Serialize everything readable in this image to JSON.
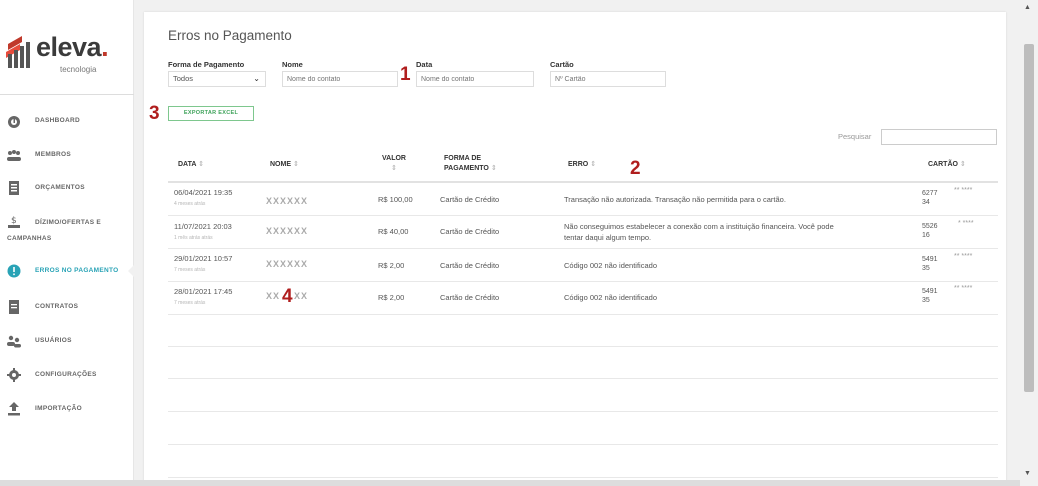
{
  "brand": {
    "name": "eleva",
    "dot": ".",
    "tagline": "tecnologia"
  },
  "sidebar": {
    "items": [
      {
        "label": "DASHBOARD",
        "icon": "dashboard-icon"
      },
      {
        "label": "MEMBROS",
        "icon": "members-icon"
      },
      {
        "label": "ORÇAMENTOS",
        "icon": "budget-icon"
      },
      {
        "label": "DÍZIMO/OFERTAS E",
        "label2": "CAMPANHAS",
        "icon": "tithe-icon"
      },
      {
        "label": "ERROS NO PAGAMENTO",
        "icon": "alert-icon",
        "active": true
      },
      {
        "label": "CONTRATOS",
        "icon": "contract-icon"
      },
      {
        "label": "USUÁRIOS",
        "icon": "users-icon"
      },
      {
        "label": "CONFIGURAÇÕES",
        "icon": "gear-icon"
      },
      {
        "label": "IMPORTAÇÃO",
        "icon": "upload-icon"
      }
    ]
  },
  "page": {
    "title": "Erros no Pagamento"
  },
  "filters": {
    "payment_method": {
      "label": "Forma de Pagamento",
      "value": "Todos"
    },
    "name": {
      "label": "Nome",
      "placeholder": "Nome do contato"
    },
    "date": {
      "label": "Data",
      "placeholder": "Nome do contato"
    },
    "card": {
      "label": "Cartão",
      "placeholder": "Nº Cartão"
    }
  },
  "export_button": "EXPORTAR EXCEL",
  "search": {
    "label": "Pesquisar"
  },
  "table": {
    "columns": {
      "date": "DATA",
      "name": "NOME",
      "value_line1": "VALOR",
      "method_line1": "FORMA DE",
      "method_line2": "PAGAMENTO",
      "error": "ERRO",
      "card": "CARTÃO"
    },
    "sort_glyph": "⇕",
    "rows": [
      {
        "date": "06/04/2021 19:35",
        "ago": "4 meses atrás",
        "name": "XXXXXX",
        "value": "R$ 100,00",
        "method": "Cartão de Crédito",
        "error1": "Transação não autorizada. Transação não permitida para o cartão.",
        "error2": "",
        "card1": "6277",
        "card2": "34",
        "card_mask": "** ****"
      },
      {
        "date": "11/07/2021 20:03",
        "ago": "1 mês atrás atrás",
        "name": "XXXXXX",
        "value": "R$ 40,00",
        "method": "Cartão de Crédito",
        "error1": "Não conseguimos estabelecer a conexão com a instituição financeira. Você pode",
        "error2": "tentar daqui algum tempo.",
        "card1": "5526",
        "card2": "16",
        "card_mask": "* ****"
      },
      {
        "date": "29/01/2021 10:57",
        "ago": "7 meses atrás",
        "name": "XXXXXX",
        "value": "R$ 2,00",
        "method": "Cartão de Crédito",
        "error1": "Código 002 não identificado",
        "error2": "",
        "card1": "5491",
        "card2": "35",
        "card_mask": "** ****"
      },
      {
        "date": "28/01/2021 17:45",
        "ago": "7 meses atrás",
        "name": "XX    XX",
        "value": "R$ 2,00",
        "method": "Cartão de Crédito",
        "error1": "Código 002 não identificado",
        "error2": "",
        "card1": "5491",
        "card2": "35",
        "card_mask": "** ****"
      }
    ]
  },
  "markers": {
    "m1": "1",
    "m2": "2",
    "m3": "3",
    "m4": "4"
  },
  "colors": {
    "accent": "#29a3b6",
    "marker": "#b01e1e",
    "export": "#3fa35b"
  }
}
